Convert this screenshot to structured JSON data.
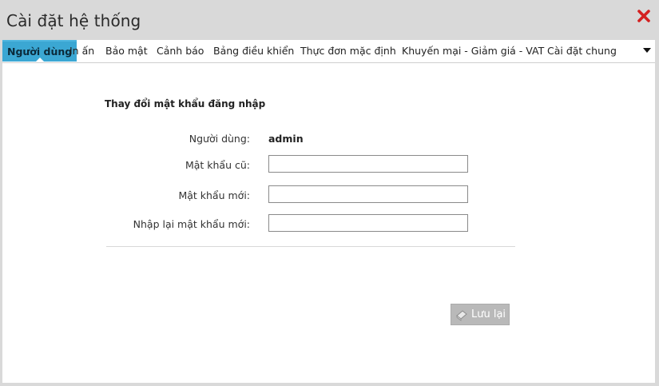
{
  "window": {
    "title": "Cài đặt hệ thống",
    "close_icon": "close-icon"
  },
  "tabs": [
    {
      "label": "Người dùng",
      "active": true
    },
    {
      "label": "In ấn",
      "active": false
    },
    {
      "label": "Bảo mật",
      "active": false
    },
    {
      "label": "Cảnh báo",
      "active": false
    },
    {
      "label": "Bảng điều khiển",
      "active": false
    },
    {
      "label": "Thực đơn mặc định",
      "active": false
    },
    {
      "label": "Khuyến mại - Giảm giá - VAT",
      "active": false
    },
    {
      "label": "Cài đặt chung",
      "active": false
    }
  ],
  "form": {
    "section_title": "Thay đổi mật khẩu đăng nhập",
    "user_label": "Người dùng:",
    "user_value": "admin",
    "old_password_label": "Mật khẩu cũ:",
    "old_password_value": "",
    "new_password_label": "Mật khẩu mới:",
    "new_password_value": "",
    "confirm_password_label": "Nhập lại mật khẩu mới:",
    "confirm_password_value": ""
  },
  "actions": {
    "save_label": "Lưu lại"
  },
  "colors": {
    "active_tab": "#3ba7d3",
    "close": "#d42020",
    "save_button": "#b9b9b9"
  }
}
